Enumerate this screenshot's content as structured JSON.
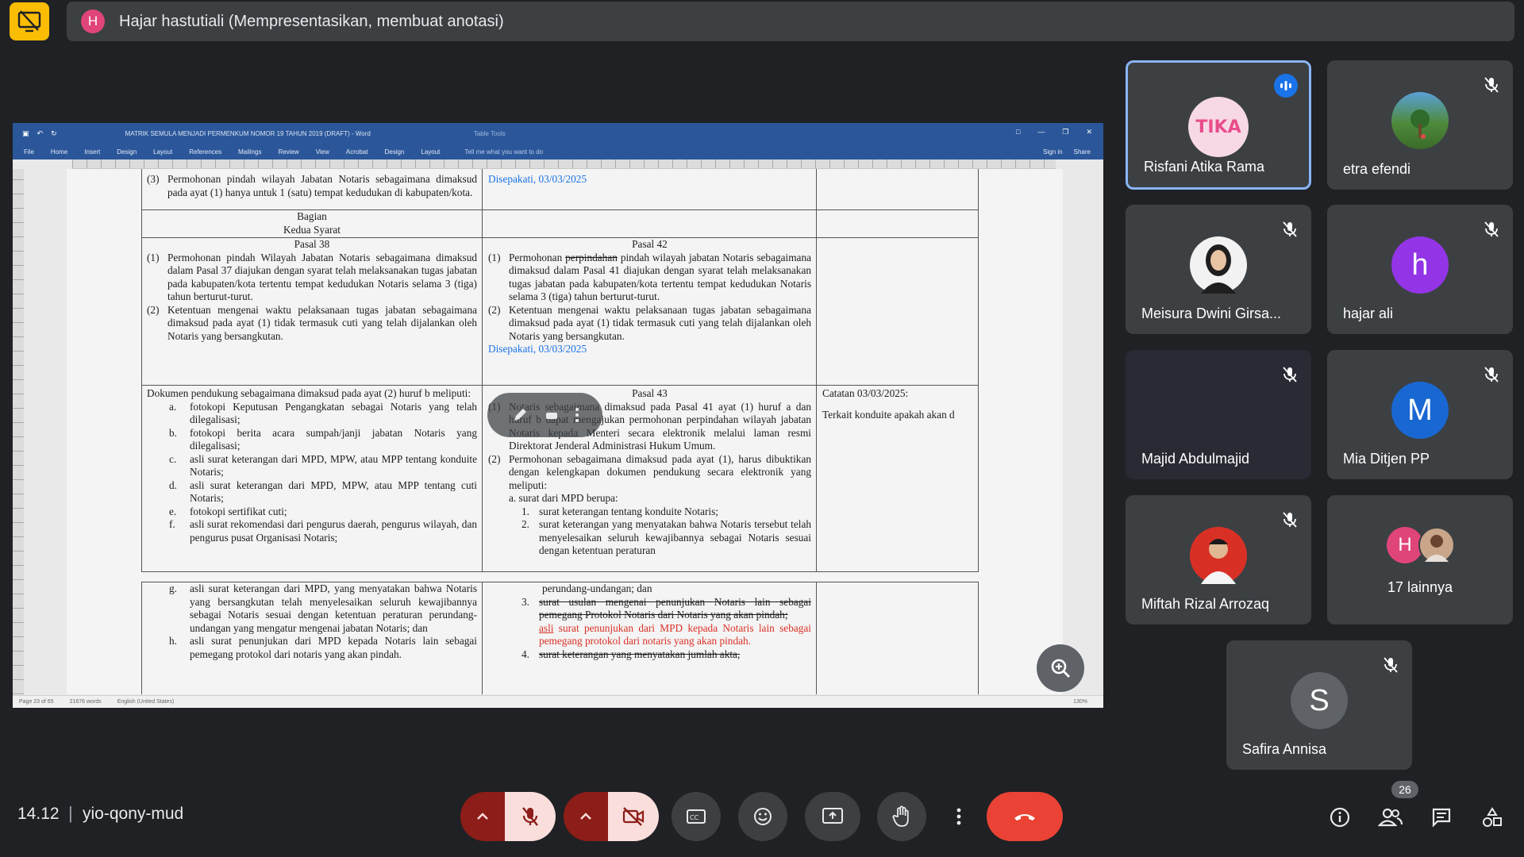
{
  "presenter": {
    "avatar_letter": "H",
    "label": "Hajar hastutiali (Mempresentasikan, membuat anotasi)"
  },
  "word": {
    "doc_title": "MATRIK SEMULA MENJADI PERMENKUM NOMOR 19 TAHUN 2019 (DRAFT) - Word",
    "table_tools": "Table Tools",
    "tabs": [
      "File",
      "Home",
      "Insert",
      "Design",
      "Layout",
      "References",
      "Mailings",
      "Review",
      "View",
      "Acrobat",
      "Design",
      "Layout"
    ],
    "tell_me": "Tell me what you want to do",
    "sign_in": "Sign in",
    "share": "Share",
    "status_page": "Page 23 of 65",
    "status_words": "21676 words",
    "status_lang": "English (United States)",
    "status_zoom": "130%"
  },
  "doc": {
    "r1_left_num": "(3)",
    "r1_left_text": "Permohonan pindah wilayah Jabatan Notaris sebagaimana dimaksud pada ayat (1) hanya untuk 1 (satu) tempat kedudukan di kabupaten/kota.",
    "r1_mid": "Disepakati, 03/03/2025",
    "bagian_title": "Bagian",
    "bagian_sub": "Kedua Syarat",
    "pasal38": "Pasal 38",
    "p38_1_num": "(1)",
    "p38_1": "Permohonan pindah Wilayah Jabatan Notaris sebagaimana dimaksud dalam Pasal 37 diajukan dengan syarat telah melaksanakan tugas jabatan pada kabupaten/kota tertentu tempat kedudukan Notaris selama 3 (tiga) tahun berturut-turut.",
    "p38_2_num": "(2)",
    "p38_2": "Ketentuan mengenai waktu pelaksanaan tugas jabatan sebagaimana dimaksud pada ayat (1) tidak termasuk cuti yang telah dijalankan oleh Notaris yang bersangkutan.",
    "pasal42": "Pasal 42",
    "p42_1_num": "(1)",
    "p42_1a": "Permohonan",
    "p42_1_strike": "perpindahan",
    "p42_1b": "pindah wilayah jabatan Notaris sebagaimana dimaksud dalam Pasal 41 diajukan dengan syarat telah melaksanakan tugas jabatan pada kabupaten/kota tertentu tempat kedudukan Notaris selama 3 (tiga) tahun berturut-turut.",
    "p42_2_num": "(2)",
    "p42_2": "Ketentuan mengenai waktu pelaksanaan tugas jabatan sebagaimana dimaksud pada ayat (1) tidak termasuk cuti yang telah dijalankan oleh Notaris yang bersangkutan.",
    "r3_mid_agree": "Disepakati, 03/03/2025",
    "dok_intro": "Dokumen pendukung sebagaimana dimaksud pada ayat (2) huruf b meliputi:",
    "dok_items": [
      {
        "n": "a.",
        "t": "fotokopi Keputusan Pengangkatan sebagai Notaris yang telah dilegalisasi;"
      },
      {
        "n": "b.",
        "t": "fotokopi berita acara sumpah/janji jabatan Notaris yang dilegalisasi;"
      },
      {
        "n": "c.",
        "t": "asli surat keterangan dari MPD, MPW, atau MPP tentang konduite Notaris;"
      },
      {
        "n": "d.",
        "t": "asli surat keterangan dari MPD, MPW, atau MPP tentang cuti Notaris;"
      },
      {
        "n": "e.",
        "t": "fotokopi sertifikat cuti;"
      },
      {
        "n": "f.",
        "t": "asli surat rekomendasi dari pengurus daerah, pengurus wilayah, dan pengurus pusat Organisasi Notaris;"
      }
    ],
    "pasal43": "Pasal 43",
    "p43_1_num": "(1)",
    "p43_1": "Notaris sebagaimana dimaksud pada Pasal 41 ayat (1) huruf a dan huruf b dapat mengajukan permohonan perpindahan wilayah jabatan Notaris kepada Menteri secara elektronik melalui laman resmi Direktorat Jenderal Administrasi Hukum Umum.",
    "p43_2_num": "(2)",
    "p43_2": "Permohonan sebagaimana dimaksud pada ayat (1), harus dibuktikan dengan kelengkapan dokumen pendukung secara elektronik yang meliputi:",
    "p43_a": "a. surat dari MPD berupa:",
    "p43_a_items": [
      {
        "n": "1.",
        "t": "surat keterangan tentang konduite Notaris;"
      },
      {
        "n": "2.",
        "t": "surat keterangan yang menyatakan bahwa Notaris tersebut telah menyelesaikan seluruh kewajibannya sebagai Notaris sesuai dengan ketentuan peraturan"
      }
    ],
    "catatan": "Catatan 03/03/2025:",
    "catatan_text": "Terkait konduite apakah akan d",
    "r4_items": [
      {
        "n": "g.",
        "t": "asli surat keterangan dari MPD, yang menyatakan bahwa Notaris yang bersangkutan telah menyelesaikan seluruh kewajibannya sebagai Notaris sesuai dengan ketentuan peraturan perundang-undangan yang mengatur mengenai jabatan Notaris; dan"
      },
      {
        "n": "h.",
        "t": "asli surat penunjukan dari MPD kepada Notaris lain sebagai pemegang protokol dari notaris yang akan pindah."
      }
    ],
    "r4_mid_cont": "perundang-undangan; dan",
    "r4_mid_3_num": "3.",
    "r4_mid_3_strike": "surat usulan mengenai penunjukan Notaris lain sebagai pemegang Protokol Notaris dari Notaris yang akan pindah;",
    "r4_mid_3_red_u": "asli",
    "r4_mid_3_red": "surat penunjukan dari MPD kepada Notaris lain sebagai pemegang protokol dari notaris yang akan pindah.",
    "r4_mid_4_num": "4.",
    "r4_mid_4_strike": "surat keterangan yang menyatakan jumlah akta,"
  },
  "participants": [
    {
      "name": "Risfani Atika Rama",
      "avatar_text": "TIKA",
      "speaking": true
    },
    {
      "name": "etra efendi",
      "muted": true
    },
    {
      "name": "Meisura Dwini Girsa...",
      "muted": true
    },
    {
      "name": "hajar ali",
      "avatar_letter": "h",
      "avatar_color": "#9334e6",
      "muted": true
    },
    {
      "name": "Majid Abdulmajid",
      "muted": true
    },
    {
      "name": "Mia Ditjen PP",
      "avatar_letter": "M",
      "avatar_color": "#1967d2",
      "muted": true
    },
    {
      "name": "Miftah Rizal Arrozaq",
      "muted": true
    },
    {
      "name": "17 lainnya",
      "avatar_letter": "H",
      "avatar_color": "#e0457a"
    },
    {
      "name": "Safira Annisa",
      "avatar_letter": "S",
      "avatar_color": "#5f6368",
      "muted": true
    }
  ],
  "bottom": {
    "time": "14.12",
    "divider": "|",
    "meeting_code": "yio-qony-mud",
    "people_count": "26"
  },
  "colors": {
    "background": "#202124",
    "tile": "#3c4043",
    "accent_blue": "#8ab4f8",
    "end_call_red": "#ea4335",
    "presenter_badge": "#fbbc04"
  }
}
